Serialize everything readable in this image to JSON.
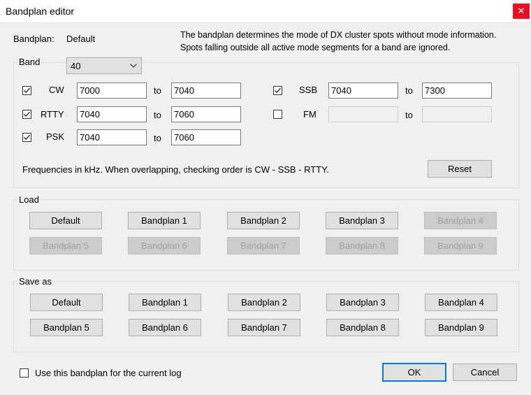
{
  "window": {
    "title": "Bandplan editor",
    "close_glyph": "✕"
  },
  "bandplan": {
    "label": "Bandplan:",
    "value": "Default"
  },
  "info": {
    "line1": "The bandplan determines the mode of DX cluster spots without mode information.",
    "line2": "Spots falling outside all active mode segments for a band are ignored."
  },
  "band": {
    "legend": "Band",
    "selected": "40"
  },
  "modes": {
    "to_label": "to",
    "cw": {
      "label": "CW",
      "checked": true,
      "from": "7000",
      "to": "7040"
    },
    "rtty": {
      "label": "RTTY",
      "checked": true,
      "from": "7040",
      "to": "7060"
    },
    "psk": {
      "label": "PSK",
      "checked": true,
      "from": "7040",
      "to": "7060"
    },
    "ssb": {
      "label": "SSB",
      "checked": true,
      "from": "7040",
      "to": "7300"
    },
    "fm": {
      "label": "FM",
      "checked": false,
      "from": "",
      "to": ""
    }
  },
  "freq_note": "Frequencies in kHz. When overlapping, checking order is CW - SSB - RTTY.",
  "reset_label": "Reset",
  "load": {
    "legend": "Load",
    "buttons": [
      {
        "label": "Default",
        "enabled": true
      },
      {
        "label": "Bandplan 1",
        "enabled": true
      },
      {
        "label": "Bandplan 2",
        "enabled": true
      },
      {
        "label": "Bandplan 3",
        "enabled": true
      },
      {
        "label": "Bandplan 4",
        "enabled": false
      },
      {
        "label": "Bandplan 5",
        "enabled": false
      },
      {
        "label": "Bandplan 6",
        "enabled": false
      },
      {
        "label": "Bandplan 7",
        "enabled": false
      },
      {
        "label": "Bandplan 8",
        "enabled": false
      },
      {
        "label": "Bandplan 9",
        "enabled": false
      }
    ]
  },
  "save": {
    "legend": "Save as",
    "buttons": [
      {
        "label": "Default",
        "enabled": true
      },
      {
        "label": "Bandplan 1",
        "enabled": true
      },
      {
        "label": "Bandplan 2",
        "enabled": true
      },
      {
        "label": "Bandplan 3",
        "enabled": true
      },
      {
        "label": "Bandplan 4",
        "enabled": true
      },
      {
        "label": "Bandplan 5",
        "enabled": true
      },
      {
        "label": "Bandplan 6",
        "enabled": true
      },
      {
        "label": "Bandplan 7",
        "enabled": true
      },
      {
        "label": "Bandplan 8",
        "enabled": true
      },
      {
        "label": "Bandplan 9",
        "enabled": true
      }
    ]
  },
  "use_current_log": {
    "label": "Use this bandplan for the current log",
    "checked": false
  },
  "ok_label": "OK",
  "cancel_label": "Cancel"
}
